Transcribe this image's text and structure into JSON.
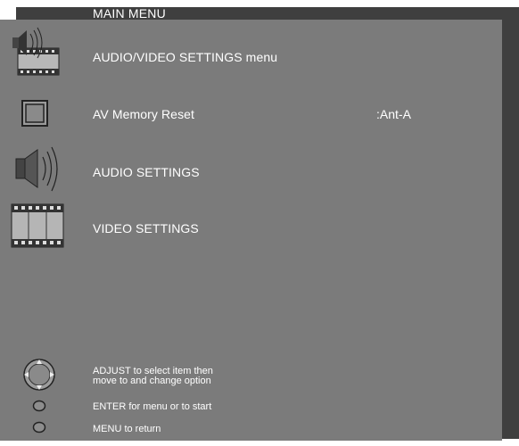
{
  "header": {
    "title": "MAIN MENU"
  },
  "menu": {
    "items": [
      {
        "label": "AUDIO/VIDEO SETTINGS menu",
        "value": "",
        "icon": "speaker-film-icon"
      },
      {
        "label": "AV Memory Reset",
        "value": ":Ant-A",
        "icon": "square-icon"
      },
      {
        "label": "AUDIO SETTINGS",
        "value": "",
        "icon": "speaker-icon"
      },
      {
        "label": "VIDEO SETTINGS",
        "value": "",
        "icon": "film-icon"
      }
    ]
  },
  "help": {
    "adjust_line1": "ADJUST to select item then",
    "adjust_line2": "move to and change option",
    "enter": "ENTER for menu or to start",
    "menu": "MENU to return"
  },
  "colors": {
    "panel": "#7b7b7b",
    "shadow": "#3f3f3f",
    "text": "#ffffff"
  }
}
